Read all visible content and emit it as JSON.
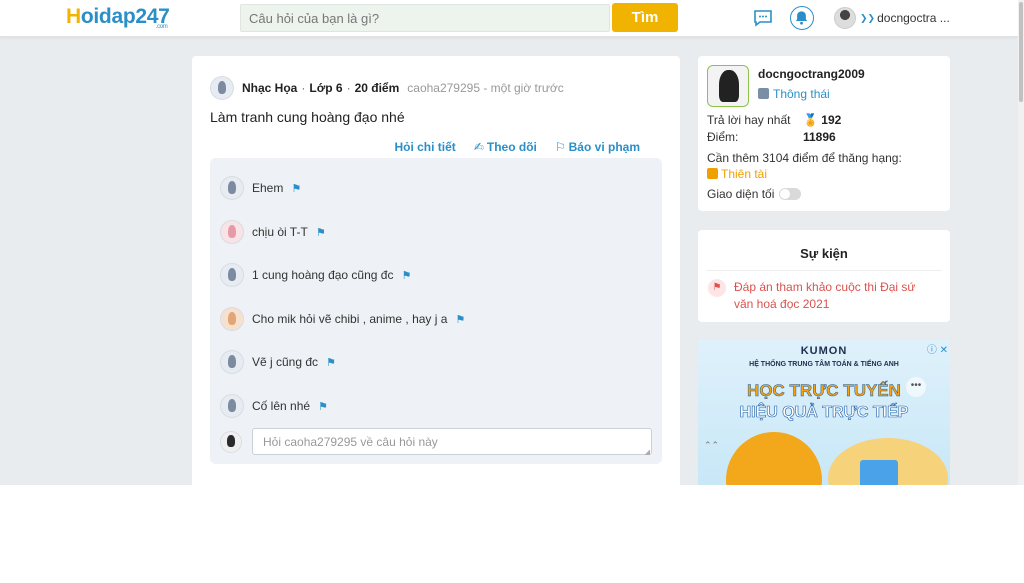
{
  "header": {
    "logo_h": "H",
    "logo_rest": "oidap247",
    "logo_com": ".com",
    "search_placeholder": "Câu hỏi của bạn là gì?",
    "search_button": "Tìm",
    "username": "docngoctra ..."
  },
  "question": {
    "subject": "Nhạc Họa",
    "grade": "Lớp 6",
    "points": "20 điểm",
    "author_time": "caoha279295 - một giờ trước",
    "text": "Làm tranh cung hoàng đạo nhé",
    "actions": {
      "detail": "Hỏi chi tiết",
      "follow": "Theo dõi",
      "report": "Báo vi phạm"
    }
  },
  "comments": [
    {
      "text": "Ehem"
    },
    {
      "text": "chịu òi T-T"
    },
    {
      "text": "1 cung hoàng đạo cũng đc"
    },
    {
      "text": "Cho mik hỏi vẽ chibi , anime , hay j a"
    },
    {
      "text": "Vẽ j cũng đc"
    },
    {
      "text": "Cố lên nhé"
    }
  ],
  "reply_placeholder": "Hỏi caoha279295 về câu hỏi này",
  "profile": {
    "name": "docngoctrang2009",
    "rank": "Thông thái",
    "best_answers_label": "Trả lời hay nhất",
    "best_answers_value": "192",
    "points_label": "Điểm:",
    "points_value": "11896",
    "next_rank_text": "Cần thêm 3104 điểm để thăng hạng:",
    "next_rank": "Thiên tài",
    "dark_mode_label": "Giao diện tối",
    "dark_mode_on": false
  },
  "events": {
    "title": "Sự kiện",
    "item": "Đáp án tham khảo cuộc thi Đại sứ văn hoá đọc 2021"
  },
  "ad": {
    "brand": "KUMON",
    "subtitle": "HỆ THỐNG TRUNG TÂM TOÁN & TIẾNG ANH",
    "headline1": "HỌC TRỰC TUYẾN",
    "headline2": "HIỆU QUẢ TRỰC TIẾP"
  }
}
